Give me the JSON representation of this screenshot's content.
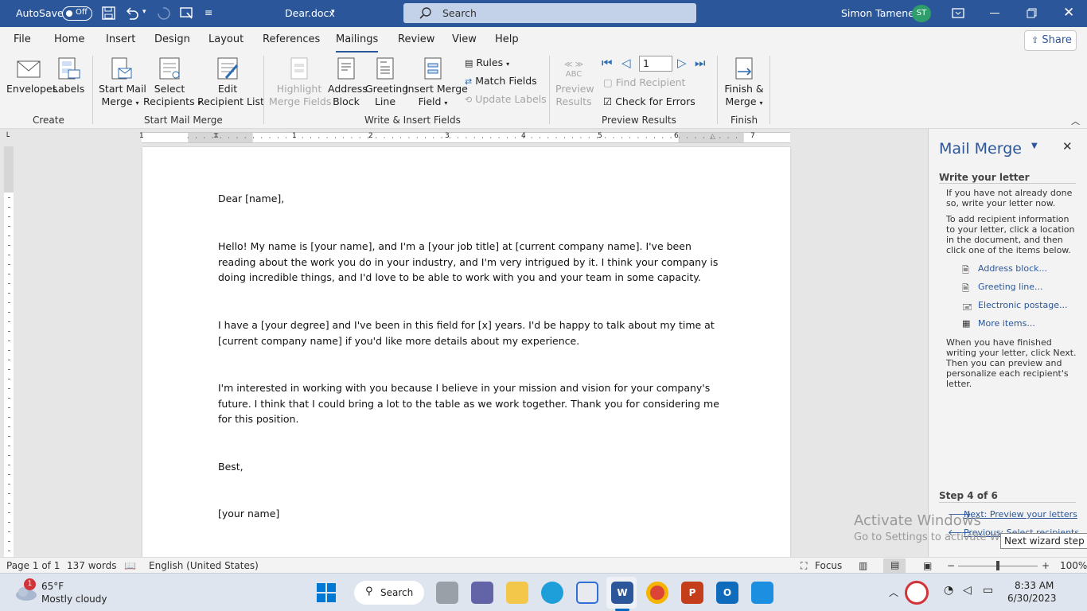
{
  "titlebar": {
    "autosave_label": "AutoSave",
    "autosave_state": "Off",
    "doc_name": "Dear.docx",
    "search_placeholder": "Search",
    "user_name": "Simon Tamene",
    "user_initials": "ST"
  },
  "tabs": [
    "File",
    "Home",
    "Insert",
    "Design",
    "Layout",
    "References",
    "Mailings",
    "Review",
    "View",
    "Help"
  ],
  "active_tab": "Mailings",
  "share_label": "Share",
  "ribbon": {
    "create": {
      "label": "Create",
      "envelopes": "Envelopes",
      "labels": "Labels"
    },
    "start": {
      "label": "Start Mail Merge",
      "start_l1": "Start Mail",
      "start_l2": "Merge",
      "select_l1": "Select",
      "select_l2": "Recipients",
      "edit_l1": "Edit",
      "edit_l2": "Recipient List"
    },
    "write": {
      "label": "Write & Insert Fields",
      "highlight_l1": "Highlight",
      "highlight_l2": "Merge Fields",
      "address_l1": "Address",
      "address_l2": "Block",
      "greeting_l1": "Greeting",
      "greeting_l2": "Line",
      "insert_l1": "Insert Merge",
      "insert_l2": "Field",
      "rules": "Rules",
      "match": "Match Fields",
      "update": "Update Labels"
    },
    "preview": {
      "label": "Preview Results",
      "preview_l1": "Preview",
      "preview_l2": "Results",
      "abc": "ABC",
      "record": "1",
      "find": "Find Recipient",
      "check": "Check for Errors"
    },
    "finish": {
      "label": "Finish",
      "finish_l1": "Finish &",
      "finish_l2": "Merge"
    }
  },
  "document": {
    "p1": "Dear [name],",
    "p2": "Hello! My name is [your name], and I'm a [your job title] at [current company name]. I've been reading about the work you do in your industry, and I'm very intrigued by it. I think your company is doing incredible things, and I'd love to be able to work with you and your team in some capacity.",
    "p3": "I have a [your degree] and I've been in this field for [x] years. I'd be happy to talk about my time at [current company name] if you'd like more details about my experience.",
    "p4": "I'm interested in working with you because I believe in your mission and vision for your company's future. I think that I could bring a lot to the table as we work together. Thank you for considering me for this position.",
    "p5": "Best,",
    "p6": "[your name]"
  },
  "ruler_numbers": [
    "1",
    "1",
    "2",
    "3",
    "4",
    "5",
    "6",
    "7"
  ],
  "pane": {
    "title": "Mail Merge",
    "heading": "Write your letter",
    "t1": [
      "If you have not already done",
      "so, write your letter now."
    ],
    "t2": [
      "To add recipient information",
      "to your letter, click a location",
      "in the document, and then",
      "click one of the items below."
    ],
    "links": [
      "Address block...",
      "Greeting line...",
      "Electronic postage...",
      "More items..."
    ],
    "t3": [
      "When you have finished",
      "writing your letter, click Next.",
      "Then you can preview and",
      "personalize each recipient's",
      "letter."
    ],
    "step": "Step 4 of 6",
    "next": "Next: Preview your letters",
    "previous": "Previous: Select recipients"
  },
  "tooltip": "Next wizard step",
  "watermark": {
    "line1": "Activate Windows",
    "line2": "Go to Settings to activate Windows."
  },
  "status": {
    "page": "Page 1 of 1",
    "words": "137 words",
    "language": "English (United States)",
    "focus": "Focus",
    "zoom": "100%"
  },
  "taskbar": {
    "temp": "65°F",
    "weather": "Mostly cloudy",
    "badge": "1",
    "search": "Search",
    "time": "8:33 AM",
    "date": "6/30/2023"
  },
  "colors": {
    "word_blue": "#2b579a",
    "link": "#2b579a"
  }
}
